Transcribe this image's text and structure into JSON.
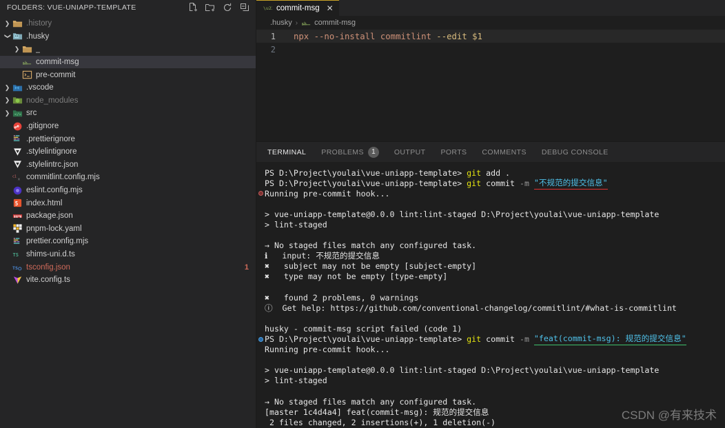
{
  "sidebar": {
    "title": "FOLDERS: VUE-UNIAPP-TEMPLATE",
    "actions": [
      {
        "name": "new-file-icon",
        "label": "New File"
      },
      {
        "name": "new-folder-icon",
        "label": "New Folder"
      },
      {
        "name": "refresh-icon",
        "label": "Refresh Explorer"
      },
      {
        "name": "collapse-all-icon",
        "label": "Collapse Folders in Explorer"
      }
    ],
    "tree": [
      {
        "label": ".history",
        "indent": 0,
        "type": "folder",
        "arrow": "right",
        "icon": "folder-history-icon",
        "dim": true
      },
      {
        "label": ".husky",
        "indent": 0,
        "type": "folder",
        "arrow": "down",
        "icon": "folder-husky-icon"
      },
      {
        "label": "_",
        "indent": 1,
        "type": "folder",
        "arrow": "right",
        "icon": "folder-icon"
      },
      {
        "label": "commit-msg",
        "indent": 1,
        "type": "file",
        "arrow": "none",
        "icon": "shell-script-icon",
        "selected": true
      },
      {
        "label": "pre-commit",
        "indent": 1,
        "type": "file",
        "arrow": "none",
        "icon": "console-icon"
      },
      {
        "label": ".vscode",
        "indent": 0,
        "type": "folder",
        "arrow": "right",
        "icon": "folder-vscode-icon"
      },
      {
        "label": "node_modules",
        "indent": 0,
        "type": "folder",
        "arrow": "right",
        "icon": "folder-node-icon",
        "dim": true
      },
      {
        "label": "src",
        "indent": 0,
        "type": "folder",
        "arrow": "right",
        "icon": "folder-src-icon"
      },
      {
        "label": ".gitignore",
        "indent": 0,
        "type": "file",
        "arrow": "none",
        "icon": "git-icon"
      },
      {
        "label": ".prettierignore",
        "indent": 0,
        "type": "file",
        "arrow": "none",
        "icon": "prettier-icon"
      },
      {
        "label": ".stylelintignore",
        "indent": 0,
        "type": "file",
        "arrow": "none",
        "icon": "stylelint-icon"
      },
      {
        "label": ".stylelintrc.json",
        "indent": 0,
        "type": "file",
        "arrow": "none",
        "icon": "stylelint-icon"
      },
      {
        "label": "commitlint.config.mjs",
        "indent": 0,
        "type": "file",
        "arrow": "none",
        "icon": "commitlint-icon"
      },
      {
        "label": "eslint.config.mjs",
        "indent": 0,
        "type": "file",
        "arrow": "none",
        "icon": "eslint-icon"
      },
      {
        "label": "index.html",
        "indent": 0,
        "type": "file",
        "arrow": "none",
        "icon": "html-icon"
      },
      {
        "label": "package.json",
        "indent": 0,
        "type": "file",
        "arrow": "none",
        "icon": "npm-icon"
      },
      {
        "label": "pnpm-lock.yaml",
        "indent": 0,
        "type": "file",
        "arrow": "none",
        "icon": "pnpm-icon"
      },
      {
        "label": "prettier.config.mjs",
        "indent": 0,
        "type": "file",
        "arrow": "none",
        "icon": "prettier-icon"
      },
      {
        "label": "shims-uni.d.ts",
        "indent": 0,
        "type": "file",
        "arrow": "none",
        "icon": "typescript-icon"
      },
      {
        "label": "tsconfig.json",
        "indent": 0,
        "type": "file",
        "arrow": "none",
        "icon": "tsconfig-icon",
        "problem": "1",
        "warn": true
      },
      {
        "label": "vite.config.ts",
        "indent": 0,
        "type": "file",
        "arrow": "none",
        "icon": "vite-icon"
      }
    ]
  },
  "editor": {
    "tab": {
      "label": "commit-msg",
      "close": "✕",
      "icon": "shell-script-icon"
    },
    "breadcrumb": [
      {
        "label": ".husky",
        "icon": "folder-icon"
      },
      {
        "label": "commit-msg",
        "icon": "shell-script-icon"
      }
    ],
    "breadcrumb_separator": "›",
    "lines": [
      {
        "num": "1",
        "active": true,
        "segments": [
          {
            "text": "npx --no-install commitlint ",
            "cls": "c-cmd"
          },
          {
            "text": "--edit $1",
            "cls": "c-flag"
          }
        ]
      },
      {
        "num": "2",
        "active": false,
        "segments": []
      }
    ]
  },
  "panel": {
    "tabs": [
      {
        "label": "TERMINAL",
        "active": true
      },
      {
        "label": "PROBLEMS",
        "active": false,
        "badge": "1"
      },
      {
        "label": "OUTPUT",
        "active": false
      },
      {
        "label": "PORTS",
        "active": false
      },
      {
        "label": "COMMENTS",
        "active": false
      },
      {
        "label": "DEBUG CONSOLE",
        "active": false
      }
    ],
    "terminal_lines": [
      {
        "deco": "none",
        "segments": [
          {
            "text": "PS D:\\Project\\youlai\\vue-uniapp-template> ",
            "cls": "t-white"
          },
          {
            "text": "git",
            "cls": "t-yellow"
          },
          {
            "text": " add",
            "cls": "t-white"
          },
          {
            "text": " .",
            "cls": "t-white"
          }
        ]
      },
      {
        "deco": "none",
        "segments": [
          {
            "text": "PS D:\\Project\\youlai\\vue-uniapp-template> ",
            "cls": "t-white"
          },
          {
            "text": "git",
            "cls": "t-yellow"
          },
          {
            "text": " commit ",
            "cls": "t-white"
          },
          {
            "text": "-m ",
            "cls": "t-gray"
          },
          {
            "text": "\"不规范的提交信息\"",
            "cls": "t-blue",
            "underline": "red"
          }
        ]
      },
      {
        "deco": "err",
        "segments": [
          {
            "text": "Running pre-commit hook...",
            "cls": "t-white"
          }
        ]
      },
      {
        "deco": "none",
        "segments": []
      },
      {
        "deco": "none",
        "segments": [
          {
            "text": "> vue-uniapp-template@0.0.0 lint:lint-staged D:\\Project\\youlai\\vue-uniapp-template",
            "cls": "t-white"
          }
        ]
      },
      {
        "deco": "none",
        "segments": [
          {
            "text": "> lint-staged",
            "cls": "t-white"
          }
        ]
      },
      {
        "deco": "none",
        "segments": []
      },
      {
        "deco": "none",
        "segments": [
          {
            "text": "→ No staged files match any configured task.",
            "cls": "t-white"
          }
        ]
      },
      {
        "deco": "none",
        "segments": [
          {
            "text": "ℹ   input: 不规范的提交信息",
            "cls": "t-white"
          }
        ]
      },
      {
        "deco": "none",
        "segments": [
          {
            "text": "✖   subject may not be empty [subject-empty]",
            "cls": "t-white"
          }
        ]
      },
      {
        "deco": "none",
        "segments": [
          {
            "text": "✖   type may not be empty [type-empty]",
            "cls": "t-white"
          }
        ]
      },
      {
        "deco": "none",
        "segments": []
      },
      {
        "deco": "none",
        "segments": [
          {
            "text": "✖   found 2 problems, 0 warnings",
            "cls": "t-white"
          }
        ]
      },
      {
        "deco": "none",
        "segments": [
          {
            "text": "ⓘ  Get help: https://github.com/conventional-changelog/commitlint/#what-is-commitlint",
            "cls": "t-white"
          }
        ]
      },
      {
        "deco": "none",
        "segments": []
      },
      {
        "deco": "none",
        "segments": [
          {
            "text": "husky - commit-msg script failed (code 1)",
            "cls": "t-white"
          }
        ]
      },
      {
        "deco": "ok",
        "segments": [
          {
            "text": "PS D:\\Project\\youlai\\vue-uniapp-template> ",
            "cls": "t-white"
          },
          {
            "text": "git",
            "cls": "t-yellow"
          },
          {
            "text": " commit ",
            "cls": "t-white"
          },
          {
            "text": "-m ",
            "cls": "t-gray"
          },
          {
            "text": "\"feat(commit-msg): 规范的提交信息\"",
            "cls": "t-blue",
            "underline": "green"
          }
        ]
      },
      {
        "deco": "none",
        "segments": [
          {
            "text": "Running pre-commit hook...",
            "cls": "t-white"
          }
        ]
      },
      {
        "deco": "none",
        "segments": []
      },
      {
        "deco": "none",
        "segments": [
          {
            "text": "> vue-uniapp-template@0.0.0 lint:lint-staged D:\\Project\\youlai\\vue-uniapp-template",
            "cls": "t-white"
          }
        ]
      },
      {
        "deco": "none",
        "segments": [
          {
            "text": "> lint-staged",
            "cls": "t-white"
          }
        ]
      },
      {
        "deco": "none",
        "segments": []
      },
      {
        "deco": "none",
        "segments": [
          {
            "text": "→ No staged files match any configured task.",
            "cls": "t-white"
          }
        ]
      },
      {
        "deco": "none",
        "segments": [
          {
            "text": "[master 1c4d4a4] feat(commit-msg): 规范的提交信息",
            "cls": "t-white"
          }
        ]
      },
      {
        "deco": "none",
        "segments": [
          {
            "text": " 2 files changed, 2 insertions(+), 1 deletion(-)",
            "cls": "t-white"
          }
        ]
      }
    ]
  },
  "watermark": "CSDN @有来技术",
  "colors": {
    "sidebar_bg": "#252526",
    "editor_bg": "#1e1e1e",
    "selection_bg": "#37373d",
    "accent_tab": "#c9a227",
    "accent_panel": "#4d9bd4",
    "error_underline": "#e03131",
    "success_underline": "#3ec46d",
    "problem_text": "#cf6a5a"
  }
}
